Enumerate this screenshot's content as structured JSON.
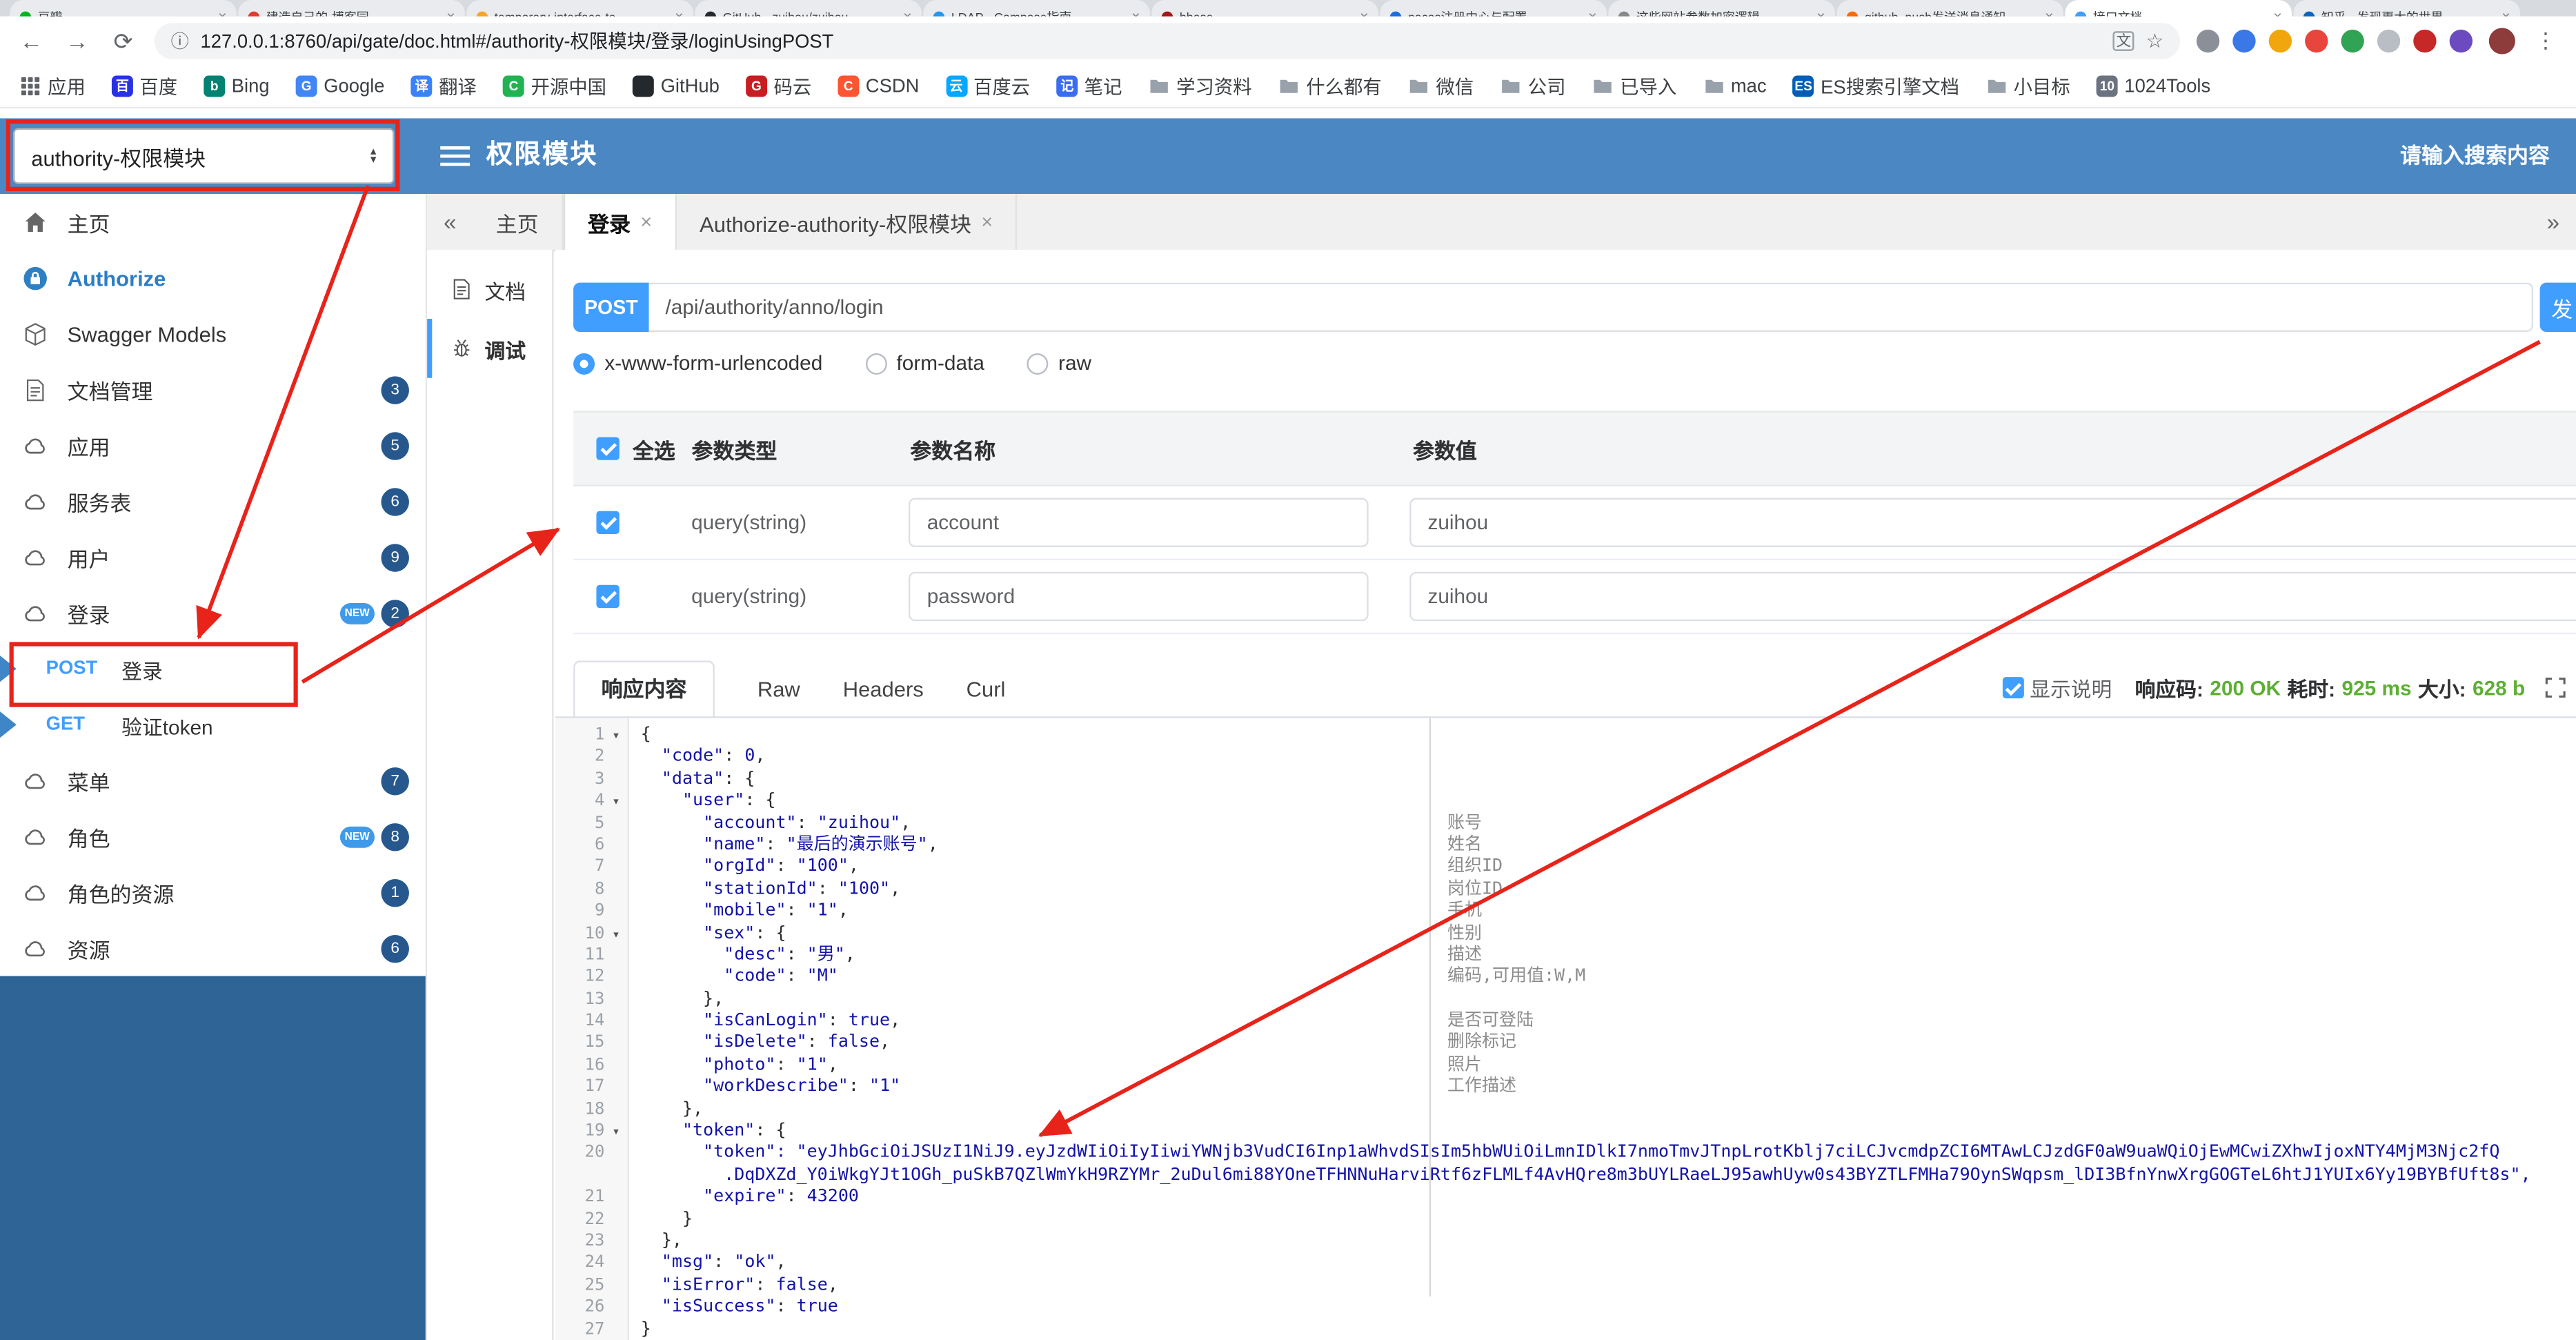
{
  "icons": {
    "back": "←",
    "forward": "→",
    "reload": "⟳",
    "info": "ⓘ",
    "star": "☆",
    "kebab": "⋮",
    "close": "×",
    "chevron_left": "«",
    "chevron_right": "»",
    "fold": "▾",
    "translate": "文"
  },
  "browser": {
    "tab_strip": [
      {
        "title": "豆瓣",
        "color": "#00b51d"
      },
      {
        "title": "建造自己的-博客园",
        "color": "#e23a2e"
      },
      {
        "title": "temporary-interface-te…",
        "color": "#f5a623"
      },
      {
        "title": "GitHub - zuihou/zuihou-…",
        "color": "#24292e"
      },
      {
        "title": "LDAP - Compose指南",
        "color": "#2496ed"
      },
      {
        "title": "hbase",
        "color": "#a01818"
      },
      {
        "title": "nacos注册中心与配置…",
        "color": "#1b6de0"
      },
      {
        "title": "这些网站参数加密逻辑…",
        "color": "#888888"
      },
      {
        "title": "github_push发送消息通知",
        "color": "#ff6a00"
      },
      {
        "title": "接口文档",
        "color": "#409eff",
        "active": true
      },
      {
        "title": "知乎 - 发现更大的世界",
        "color": "#0a66c2"
      }
    ],
    "address_url": "127.0.0.1:8760/api/gate/doc.html#/authority-权限模块/登录/loginUsingPOST",
    "extensions": [
      "#8a8f98",
      "#3b78e7",
      "#f2a60d",
      "#e8453c",
      "#31a354",
      "#b9bdc4",
      "#c62828",
      "#6c4bc1"
    ],
    "bookmarks": [
      {
        "label": "应用",
        "icon": "apps"
      },
      {
        "label": "百度",
        "icon": "letter",
        "bg": "#2932e1",
        "ch": "百"
      },
      {
        "label": "Bing",
        "icon": "letter",
        "bg": "#008373",
        "ch": "b"
      },
      {
        "label": "Google",
        "icon": "letter",
        "bg": "#4285f4",
        "ch": "G"
      },
      {
        "label": "翻译",
        "icon": "letter",
        "bg": "#3b82f6",
        "ch": "译"
      },
      {
        "label": "开源中国",
        "icon": "letter",
        "bg": "#21b351",
        "ch": "C"
      },
      {
        "label": "GitHub",
        "icon": "letter",
        "bg": "#24292e",
        "ch": ""
      },
      {
        "label": "码云",
        "icon": "letter",
        "bg": "#c71d23",
        "ch": "G"
      },
      {
        "label": "CSDN",
        "icon": "letter",
        "bg": "#fc5531",
        "ch": "C"
      },
      {
        "label": "百度云",
        "icon": "letter",
        "bg": "#06a7ff",
        "ch": "云"
      },
      {
        "label": "笔记",
        "icon": "letter",
        "bg": "#3a6df0",
        "ch": "记"
      },
      {
        "label": "学习资料",
        "icon": "folder"
      },
      {
        "label": "什么都有",
        "icon": "folder"
      },
      {
        "label": "微信",
        "icon": "folder"
      },
      {
        "label": "公司",
        "icon": "folder"
      },
      {
        "label": "已导入",
        "icon": "folder"
      },
      {
        "label": "mac",
        "icon": "folder"
      },
      {
        "label": "ES搜索引擎文档",
        "icon": "letter",
        "bg": "#005eb8",
        "ch": "ES"
      },
      {
        "label": "小目标",
        "icon": "folder"
      },
      {
        "label": "1024Tools",
        "icon": "letter",
        "bg": "#6b7280",
        "ch": "10"
      }
    ]
  },
  "header": {
    "module_select": "authority-权限模块",
    "title": "权限模块",
    "search_placeholder": "请输入搜索内容"
  },
  "sidebar": {
    "new_label": "NEW",
    "items": [
      {
        "label": "主页",
        "icon": "home"
      },
      {
        "label": "Authorize",
        "icon": "auth",
        "accent": true
      },
      {
        "label": "Swagger Models",
        "icon": "models"
      },
      {
        "label": "文档管理",
        "icon": "doc",
        "badge": "3"
      },
      {
        "label": "应用",
        "icon": "cloud",
        "badge": "5"
      },
      {
        "label": "服务表",
        "icon": "cloud",
        "badge": "6"
      },
      {
        "label": "用户",
        "icon": "cloud",
        "badge": "9"
      },
      {
        "label": "登录",
        "icon": "cloud",
        "badge": "2",
        "isNew": true,
        "children": [
          {
            "method": "POST",
            "label": "登录",
            "highlight": true
          },
          {
            "method": "GET",
            "label": "验证token"
          }
        ]
      },
      {
        "label": "菜单",
        "icon": "cloud",
        "badge": "7"
      },
      {
        "label": "角色",
        "icon": "cloud",
        "badge": "8",
        "isNew": true
      },
      {
        "label": "角色的资源",
        "icon": "cloud",
        "badge": "1"
      },
      {
        "label": "资源",
        "icon": "cloud",
        "badge": "6"
      }
    ]
  },
  "workspace": {
    "tabs": [
      {
        "label": "主页",
        "closable": false
      },
      {
        "label": "登录",
        "closable": true,
        "active": true
      },
      {
        "label": "Authorize-authority-权限模块",
        "closable": true
      }
    ]
  },
  "rail": {
    "items": [
      {
        "label": "文档",
        "icon": "doc"
      },
      {
        "label": "调试",
        "icon": "debug",
        "active": true
      }
    ]
  },
  "request": {
    "method": "POST",
    "url": "/api/authority/anno/login",
    "send_label": "发",
    "content_types": [
      {
        "label": "x-www-form-urlencoded",
        "selected": true
      },
      {
        "label": "form-data"
      },
      {
        "label": "raw"
      }
    ],
    "table": {
      "headers": [
        "全选",
        "参数类型",
        "参数名称",
        "参数值"
      ],
      "rows": [
        {
          "checked": true,
          "type": "query(string)",
          "name": "account",
          "value": "zuihou"
        },
        {
          "checked": true,
          "type": "query(string)",
          "name": "password",
          "value": "zuihou"
        }
      ]
    }
  },
  "response": {
    "tabs": [
      "响应内容",
      "Raw",
      "Headers",
      "Curl"
    ],
    "active_tab": "响应内容",
    "show_desc_label": "显示说明",
    "meta": {
      "code_label": "响应码:",
      "code": "200 OK",
      "time_label": "耗时:",
      "time": "925 ms",
      "size_label": "大小:",
      "size": "628 b"
    },
    "code_lines": [
      {
        "n": 1,
        "fold": true,
        "t": "{"
      },
      {
        "n": 2,
        "t": "  \"code\": 0,"
      },
      {
        "n": 3,
        "t": "  \"data\": {"
      },
      {
        "n": 4,
        "fold": true,
        "t": "    \"user\": {"
      },
      {
        "n": 5,
        "t": "      \"account\": \"zuihou\",",
        "c": "账号"
      },
      {
        "n": 6,
        "t": "      \"name\": \"最后的演示账号\",",
        "c": "姓名"
      },
      {
        "n": 7,
        "t": "      \"orgId\": \"100\",",
        "c": "组织ID"
      },
      {
        "n": 8,
        "t": "      \"stationId\": \"100\",",
        "c": "岗位ID"
      },
      {
        "n": 9,
        "t": "      \"mobile\": \"1\",",
        "c": "手机"
      },
      {
        "n": 10,
        "fold": true,
        "t": "      \"sex\": {",
        "c": "性别"
      },
      {
        "n": 11,
        "t": "        \"desc\": \"男\",",
        "c": "描述"
      },
      {
        "n": 12,
        "t": "        \"code\": \"M\"",
        "c": "编码,可用值:W,M"
      },
      {
        "n": 13,
        "t": "      },"
      },
      {
        "n": 14,
        "t": "      \"isCanLogin\": true,",
        "c": "是否可登陆"
      },
      {
        "n": 15,
        "t": "      \"isDelete\": false,",
        "c": "删除标记"
      },
      {
        "n": 16,
        "t": "      \"photo\": \"1\",",
        "c": "照片"
      },
      {
        "n": 17,
        "t": "      \"workDescribe\": \"1\"",
        "c": "工作描述"
      },
      {
        "n": 18,
        "t": "    },"
      },
      {
        "n": 19,
        "fold": true,
        "t": "    \"token\": {"
      },
      {
        "n": 20,
        "t": "      \"token\": \"eyJhbGciOiJSUzI1NiJ9.eyJzdWIiOiIyIiwiYWNjb3VudCI6Inp1aWhvdSIsIm5hbWUiOiLmnIDlkI7nmoTmvJTnpLrotKblj7ciLCJvcmdpZCI6MTAwLCJzdGF0aW9uaWQiOjEwMCwiZXhwIjoxNTY4MjM3Njc2fQ",
        "wrap": "        .DqDXZd_Y0iWkgYJt1OGh_puSkB7QZlWmYkH9RZYMr_2uDul6mi88YOneTFHNNuHarviRtf6zFLMLf4AvHQre8m3bUYLRaeLJ95awhUyw0s43BYZTLFMHa79OynSWqpsm_lDI3BfnYnwXrgGOGTeL6htJ1YUIx6Yy19BYBfUft8s\","
      },
      {
        "n": 21,
        "t": "      \"expire\": 43200"
      },
      {
        "n": 22,
        "t": "    }"
      },
      {
        "n": 23,
        "t": "  },"
      },
      {
        "n": 24,
        "t": "  \"msg\": \"ok\","
      },
      {
        "n": 25,
        "t": "  \"isError\": false,"
      },
      {
        "n": 26,
        "t": "  \"isSuccess\": true"
      },
      {
        "n": 27,
        "t": "}"
      }
    ]
  }
}
